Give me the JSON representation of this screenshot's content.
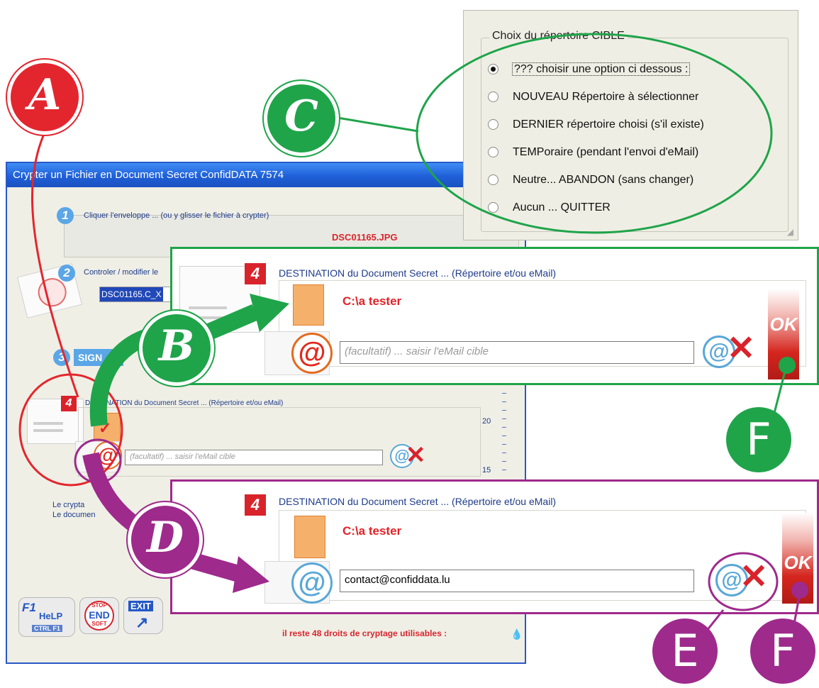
{
  "window": {
    "title": "Crypter un Fichier en Document Secret ConfidDATA 7574"
  },
  "step1": {
    "number": "1",
    "label": "Cliquer l'enveloppe ... (ou y glisser le fichier à crypter)",
    "filename": "DSC01165.JPG"
  },
  "step2": {
    "number": "2",
    "label": "Controler / modifier le",
    "field_value": "DSC01165.C_X"
  },
  "step3": {
    "number": "3",
    "label": "SIGN"
  },
  "step4": {
    "number": "4",
    "label": "DESTINATION du Document Secret ... (Répertoire et/ou eMail)",
    "email_placeholder": "(facultatif) ... saisir l'eMail cible",
    "at_symbol": "@"
  },
  "scale": {
    "label_20": "20",
    "label_15": "15"
  },
  "info_lines": [
    "Le crypta",
    "Le documen"
  ],
  "footer": {
    "remaining": "il reste 48 droits de cryptage utilisables :"
  },
  "bottom_buttons": {
    "help_top": "F1",
    "help_mid": "HeLP",
    "help_bottom": "CTRL F1",
    "stop_top": "STOP",
    "stop_mid": "END",
    "stop_bottom": "SOFT",
    "exit": "EXIT"
  },
  "choice_box": {
    "legend": "Choix du répertoire CIBLE",
    "options": [
      "??? choisir une option ci dessous :",
      "NOUVEAU Répertoire à sélectionner",
      "DERNIER répertoire choisi (s'il existe)",
      "TEMPoraire (pendant l'envoi d'eMail)",
      "Neutre... ABANDON (sans changer)",
      "Aucun ... QUITTER"
    ],
    "selected_index": 0
  },
  "zoom_green": {
    "number": "4",
    "label": "DESTINATION du Document Secret ... (Répertoire et/ou eMail)",
    "folder": "C:\\a tester",
    "email_placeholder": "(facultatif) ... saisir l'eMail cible",
    "at_symbol": "@",
    "ok": "OK"
  },
  "zoom_purple": {
    "number": "4",
    "label": "DESTINATION du Document Secret ... (Répertoire et/ou eMail)",
    "folder": "C:\\a tester",
    "email_value": "contact@confiddata.lu",
    "at_symbol": "@",
    "ok": "OK"
  },
  "badges": {
    "A": "A",
    "B": "B",
    "C": "C",
    "D": "D",
    "E": "E",
    "F1": "F",
    "F2": "F"
  },
  "colors": {
    "red": "#e3262e",
    "green": "#1fa44a",
    "purple": "#9e2a8c",
    "title_blue": "#1f5fd8"
  }
}
